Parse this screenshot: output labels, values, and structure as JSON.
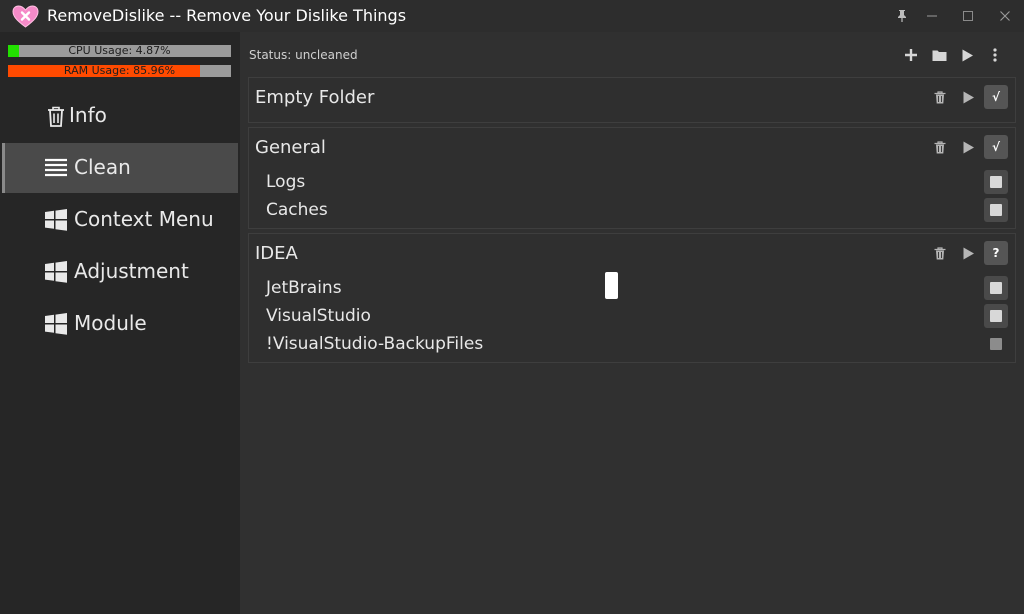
{
  "app": {
    "title": "RemoveDislike -- Remove Your Dislike Things",
    "icon": "pink-heart-x-icon",
    "window_controls": [
      "pin-icon",
      "minimize-icon",
      "maximize-icon",
      "close-icon"
    ]
  },
  "sidebar": {
    "cpu": {
      "label": "CPU Usage: 4.87%",
      "fraction": 0.0487,
      "color": "#22e000"
    },
    "ram": {
      "label": "RAM Usage: 85.96%",
      "fraction": 0.8596,
      "color": "#ff4a00"
    },
    "items": [
      {
        "label": "Info",
        "icon": "trash-icon",
        "active": false
      },
      {
        "label": "Clean",
        "icon": "list-icon",
        "active": true
      },
      {
        "label": "Context Menu",
        "icon": "windows-icon",
        "active": false
      },
      {
        "label": "Adjustment",
        "icon": "windows-icon",
        "active": false
      },
      {
        "label": "Module",
        "icon": "windows-icon",
        "active": false
      }
    ]
  },
  "main": {
    "status": "Status: uncleaned",
    "toolbar": [
      "add-icon",
      "folder-icon",
      "play-icon",
      "more-icon"
    ],
    "groups": [
      {
        "title": "Empty Folder",
        "state": "√",
        "items": []
      },
      {
        "title": "General",
        "state": "√",
        "items": [
          "Logs",
          "Caches"
        ]
      },
      {
        "title": "IDEA",
        "state": "?",
        "items": [
          "JetBrains",
          "VisualStudio",
          "!VisualStudio-BackupFiles"
        ]
      }
    ]
  },
  "colors": {
    "background": "#303030",
    "sidebar": "#262626",
    "active_item": "#4a4a4a"
  }
}
